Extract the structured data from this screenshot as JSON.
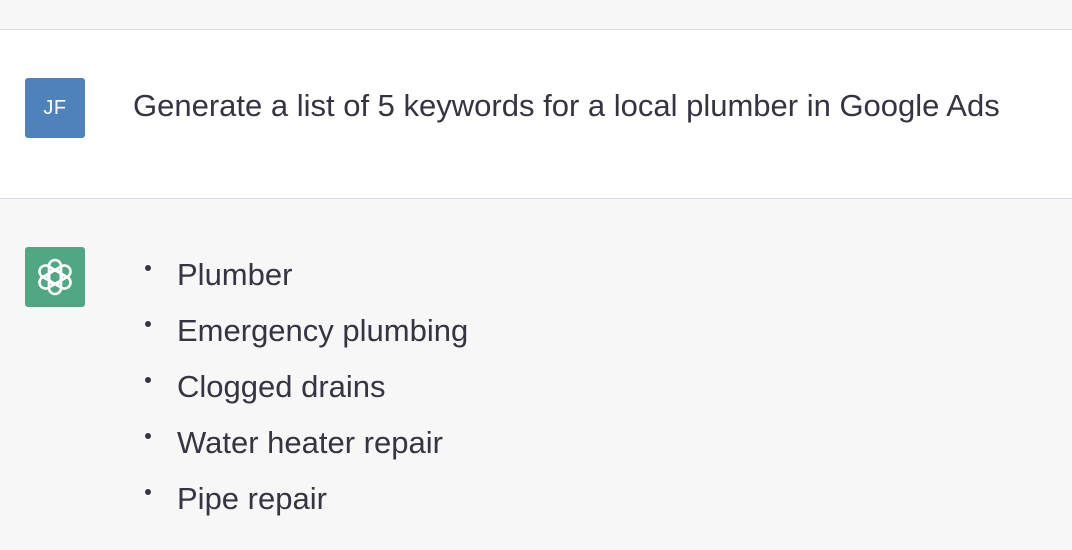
{
  "user_message": {
    "avatar_initials": "JF",
    "text": "Generate a list of 5 keywords for a local plumber in Google Ads"
  },
  "assistant_message": {
    "avatar_icon": "openai-logo-icon",
    "keywords": [
      "Plumber",
      "Emergency plumbing",
      "Clogged drains",
      "Water heater repair",
      "Pipe repair"
    ]
  },
  "colors": {
    "user_avatar_bg": "#4f82ba",
    "assistant_avatar_bg": "#4fa784",
    "user_row_bg": "#ffffff",
    "assistant_row_bg": "#f7f7f8",
    "text": "#343541"
  }
}
